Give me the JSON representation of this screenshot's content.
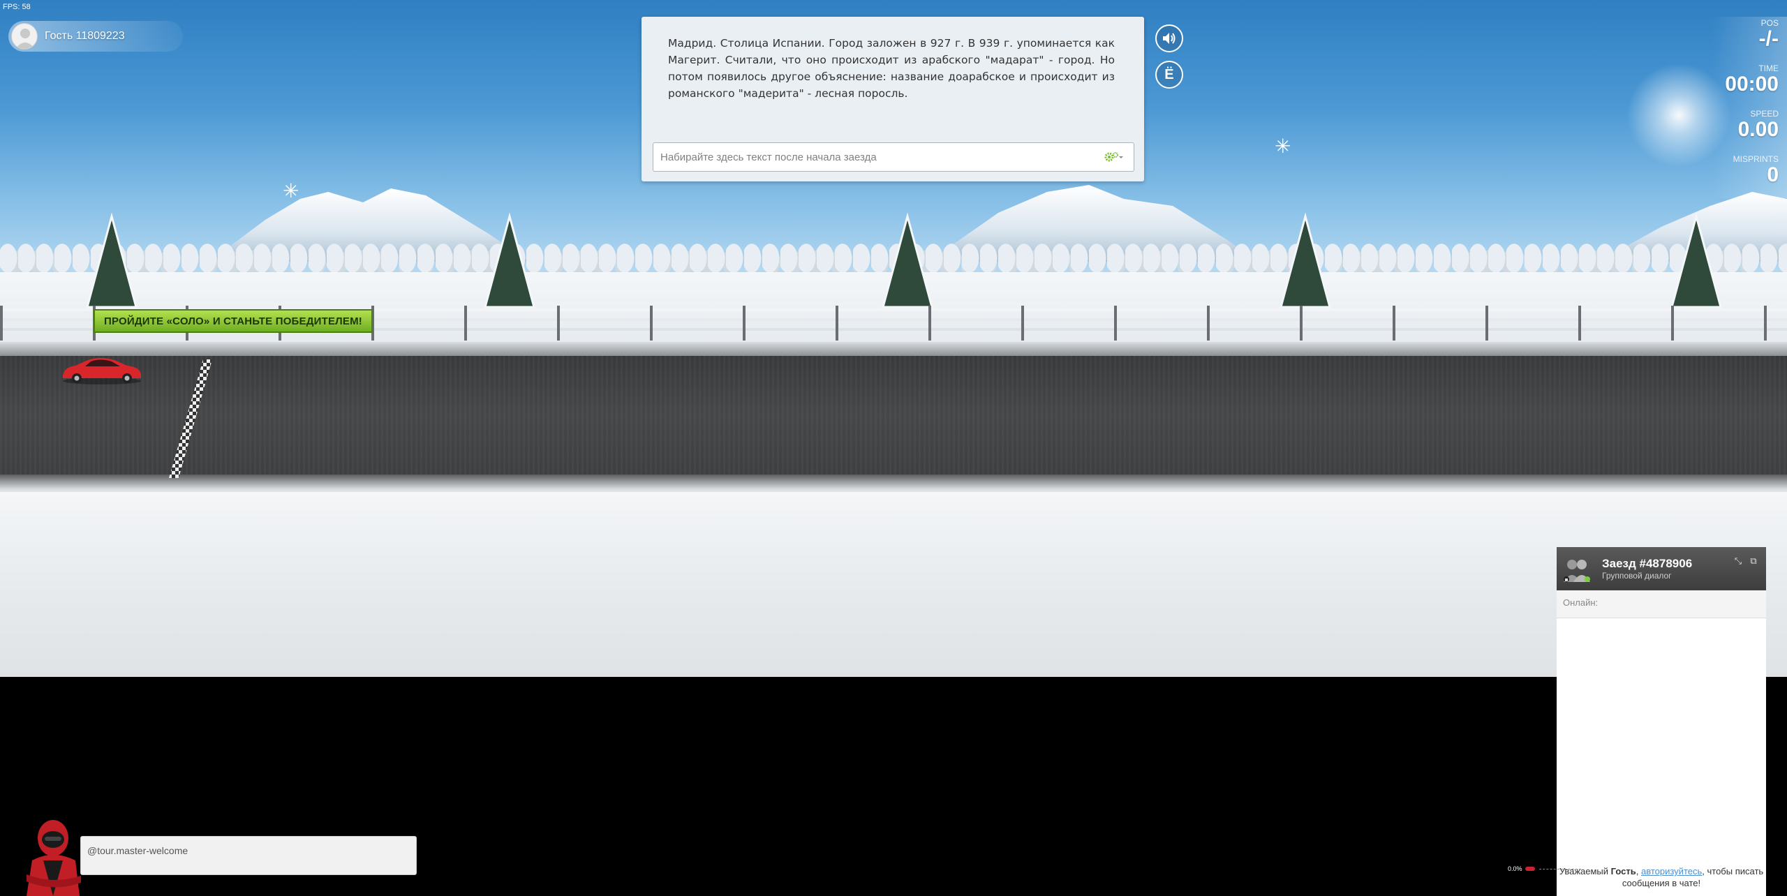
{
  "fps": "FPS: 58",
  "player": {
    "name": "Гость 11809223"
  },
  "race": {
    "text": "Мадрид. Столица Испании. Город заложен в 927 г. В 939 г. упоминается как Магерит. Считали, что оно происходит из арабского \"мадарат\" - город. Но потом появилось другое объяснение: название доарабское и происходит из романского \"мадерита\" - лесная поросль.",
    "input_placeholder": "Набирайте здесь текст после начала заезда",
    "input_value": ""
  },
  "buttons": {
    "sound_icon": "speaker-icon",
    "yo_label": "Ё"
  },
  "stats": [
    {
      "label": "POS",
      "value": "-/-"
    },
    {
      "label": "TIME",
      "value": "00:00"
    },
    {
      "label": "SPEED",
      "value": "0.00"
    },
    {
      "label": "MISPRINTS",
      "value": "0"
    }
  ],
  "banner": {
    "text": "ПРОЙДИТЕ «СОЛО» И СТАНЬТЕ ПОБЕДИТЕЛЕМ!"
  },
  "chat": {
    "title": "Заезд #4878906",
    "subtitle": "Групповой диалог",
    "online_label": "Онлайн:",
    "footer_prefix": "Уважаемый",
    "footer_user": "Гость",
    "footer_link": "авторизуйтесь",
    "footer_suffix": ", чтобы писать сообщения в чате!"
  },
  "progress": {
    "percent_label": "0.0%",
    "fraction": 0.0
  },
  "guide": {
    "message": "@tour.master-welcome"
  },
  "colors": {
    "sky_top": "#2f7fc2",
    "banner_green": "#8cc63f",
    "car_red": "#d8262b",
    "chat_header": "#4a4a4a",
    "link_blue": "#4a8fd0"
  }
}
